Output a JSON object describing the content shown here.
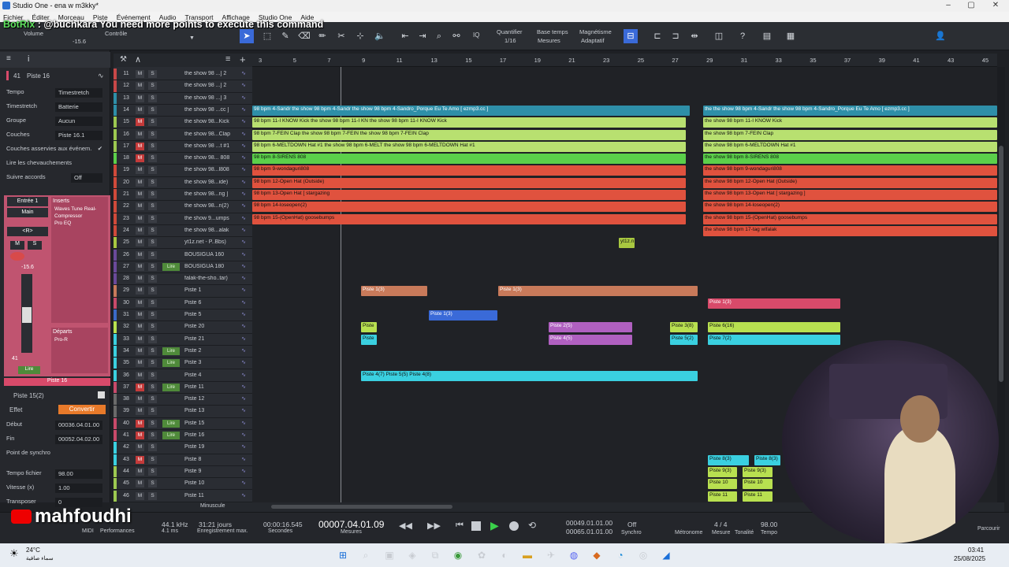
{
  "window": {
    "title": "Studio One - ena w m3kky*",
    "controls": [
      "–",
      "▢",
      "✕"
    ]
  },
  "menu": [
    "Fichier",
    "Éditer",
    "Morceau",
    "Piste",
    "Événement",
    "Audio",
    "Transport",
    "Affichage",
    "Studio One",
    "Aide"
  ],
  "chat_overlay": {
    "nick": "BotRix",
    "text": ": @buchkara You need more points to execute this command"
  },
  "toolbar": {
    "volume_label": "Volume",
    "controle_label": "Contrôle",
    "volume_value": "-15.6",
    "quantifier_label": "Quantifier",
    "quantifier_value": "1/16",
    "base_temps_label": "Base temps",
    "base_temps_value": "Mesures",
    "magnetisme_label": "Magnétisme",
    "magnetisme_value": "Adaptatif",
    "iq_label": "IQ"
  },
  "inspector": {
    "track_number": "41",
    "track_name": "Piste 16",
    "rows": [
      {
        "label": "Tempo",
        "value": "Timestretch"
      },
      {
        "label": "Timestretch",
        "value": "Batterie"
      },
      {
        "label": "Groupe",
        "value": "Aucun"
      },
      {
        "label": "Couches",
        "value": "Piste 16.1"
      },
      {
        "label": "Couches asservies aux événem.",
        "value": "✔"
      },
      {
        "label": "Lire les chevauchements",
        "value": ""
      },
      {
        "label": "Suivre accords",
        "value": "Off"
      }
    ],
    "entree": "Entrée 1",
    "main": "Main",
    "pan": "<R>",
    "m": "M",
    "s": "S",
    "fader_value": "-15.6",
    "fader_num": "41",
    "lire": "Lire",
    "inserts_label": "Inserts",
    "inserts": [
      "Waves Tune Real-",
      "Compressor",
      "Pro EQ"
    ],
    "departs_label": "Départs",
    "departs": [
      "Pro-R"
    ],
    "channel_name": "Piste 16",
    "event_name": "Piste 15(2)",
    "effet": "Effet",
    "convertir": "Convertir",
    "debut_label": "Début",
    "debut": "00036.04.01.00",
    "fin_label": "Fin",
    "fin": "00052.04.02.00",
    "point_synchro": "Point de synchro",
    "tempo_fichier_label": "Tempo fichier",
    "tempo_fichier": "98.00",
    "vitesse_label": "Vitesse (x)",
    "vitesse": "1.00",
    "transpose_label": "Transposer",
    "transpose": "0"
  },
  "ruler": [
    "3",
    "5",
    "7",
    "9",
    "11",
    "13",
    "15",
    "17",
    "19",
    "21",
    "23",
    "25",
    "27",
    "29",
    "31",
    "33",
    "35",
    "37",
    "39",
    "41",
    "43",
    "45"
  ],
  "tracks": [
    {
      "n": "11",
      "name": "the show 98 ...] 2",
      "color": "#c84848",
      "mute": false,
      "live": false
    },
    {
      "n": "12",
      "name": "the show 98 ...] 2",
      "color": "#c84848",
      "mute": false,
      "live": false
    },
    {
      "n": "13",
      "name": "the show 98 ...] 3",
      "color": "#2e8fa8",
      "mute": false,
      "live": false
    },
    {
      "n": "14",
      "name": "the show 98 ...cc ]",
      "color": "#2e8fa8",
      "mute": false,
      "live": false
    },
    {
      "n": "15",
      "name": "the show 98...Kick",
      "color": "#9cc850",
      "mute": true,
      "live": false
    },
    {
      "n": "16",
      "name": "the show 98...Clap",
      "color": "#9cc850",
      "mute": false,
      "live": false
    },
    {
      "n": "17",
      "name": "the show 98 ...t #1",
      "color": "#9cc850",
      "mute": true,
      "live": false
    },
    {
      "n": "18",
      "name": "the show 98... 808",
      "color": "#5bd04a",
      "mute": true,
      "live": false
    },
    {
      "n": "19",
      "name": "the show 98...l808",
      "color": "#d04a3a",
      "mute": false,
      "live": false
    },
    {
      "n": "20",
      "name": "the show 98...ide)",
      "color": "#d04a3a",
      "mute": false,
      "live": false
    },
    {
      "n": "21",
      "name": "the show 98...ng ]",
      "color": "#d04a3a",
      "mute": false,
      "live": false
    },
    {
      "n": "22",
      "name": "the show 98...n(2)",
      "color": "#d04a3a",
      "mute": false,
      "live": false
    },
    {
      "n": "23",
      "name": "the show 9...umps",
      "color": "#d04a3a",
      "mute": false,
      "live": false
    },
    {
      "n": "24",
      "name": "the show 98...alak",
      "color": "#d04a3a",
      "mute": false,
      "live": false
    },
    {
      "n": "25",
      "name": "yt1z.net - P..Bbs)",
      "color": "#a8c840",
      "mute": false,
      "live": false
    },
    {
      "n": "26",
      "name": "BOUSIGUA 160",
      "color": "#6a4a9a",
      "mute": false,
      "live": false
    },
    {
      "n": "27",
      "name": "BOUSIGUA 180",
      "color": "#6a4a9a",
      "mute": false,
      "live": true
    },
    {
      "n": "28",
      "name": "falak-the-sho..tar)",
      "color": "#6a4a9a",
      "mute": false,
      "live": false
    },
    {
      "n": "29",
      "name": "Piste 1",
      "color": "#c87a5a",
      "mute": false,
      "live": false
    },
    {
      "n": "30",
      "name": "Piste 6",
      "color": "#c84a6a",
      "mute": false,
      "live": false
    },
    {
      "n": "31",
      "name": "Piste 5",
      "color": "#3a6ac8",
      "mute": false,
      "live": false
    },
    {
      "n": "32",
      "name": "Piste 20",
      "color": "#b8e050",
      "mute": false,
      "live": false
    },
    {
      "n": "33",
      "name": "Piste 21",
      "color": "#3ad0e0",
      "mute": false,
      "live": false
    },
    {
      "n": "34",
      "name": "Piste 2",
      "color": "#3ad0e0",
      "mute": false,
      "live": true
    },
    {
      "n": "35",
      "name": "Piste 3",
      "color": "#3ad0e0",
      "mute": false,
      "live": true
    },
    {
      "n": "36",
      "name": "Piste 4",
      "color": "#3ad0e0",
      "mute": false,
      "live": false
    },
    {
      "n": "37",
      "name": "Piste 11",
      "color": "#c84a6a",
      "mute": true,
      "live": true
    },
    {
      "n": "38",
      "name": "Piste 12",
      "color": "#6a6a6a",
      "mute": false,
      "live": false
    },
    {
      "n": "39",
      "name": "Piste 13",
      "color": "#6a6a6a",
      "mute": false,
      "live": false
    },
    {
      "n": "40",
      "name": "Piste 15",
      "color": "#c84a6a",
      "mute": true,
      "live": true
    },
    {
      "n": "41",
      "name": "Piste 16",
      "color": "#c84a6a",
      "mute": true,
      "live": true
    },
    {
      "n": "42",
      "name": "Piste 19",
      "color": "#3ad0e0",
      "mute": false,
      "live": false
    },
    {
      "n": "43",
      "name": "Piste 8",
      "color": "#3ad0e0",
      "mute": true,
      "live": false
    },
    {
      "n": "44",
      "name": "Piste 9",
      "color": "#9cc850",
      "mute": false,
      "live": false
    },
    {
      "n": "45",
      "name": "Piste 10",
      "color": "#9cc850",
      "mute": false,
      "live": false
    },
    {
      "n": "46",
      "name": "Piste 11",
      "color": "#9cc850",
      "mute": false,
      "live": false
    }
  ],
  "clips": [
    {
      "row": 3,
      "c0": 0,
      "c1": 555,
      "color": "#2e8fa8",
      "text": "98 bpm 4-Sandr the show 98 bpm 4-Sandr the show 98 bpm 4-Sandro_Porque Eu Te Amo [ ezmp3.cc ]",
      "light": true
    },
    {
      "row": 3,
      "c0": 572,
      "c1": 945,
      "color": "#2e8fa8",
      "text": "the  the show 98 bpm 4-Sandr the show 98 bpm 4-Sandro_Porque Eu Te Amo [ ezmp3.cc ]",
      "light": true
    },
    {
      "row": 4,
      "c0": 0,
      "c1": 550,
      "color": "#b8e070",
      "text": "98 bpm 11-I KNOW Kick                                            the show 98 bpm 11-I KN the show 98 bpm 11-I KNOW Kick",
      "light": false
    },
    {
      "row": 4,
      "c0": 572,
      "c1": 945,
      "color": "#b8e070",
      "text": "the show 98 bpm 11-I KNOW Kick",
      "light": false
    },
    {
      "row": 5,
      "c0": 0,
      "c1": 550,
      "color": "#b8e070",
      "text": "98 bpm 7-FEIN Clap                                                the show 98 bpm 7-FEIN  the show 98 bpm 7-FEIN Clap",
      "light": false
    },
    {
      "row": 5,
      "c0": 572,
      "c1": 945,
      "color": "#b8e070",
      "text": "the show 98 bpm 7-FEIN Clap",
      "light": false
    },
    {
      "row": 6,
      "c0": 0,
      "c1": 550,
      "color": "#b8e070",
      "text": "98 bpm 6-MELTDOWN Hat #1                                          the show 98 bpm 6-MELT the show 98 bpm 6-MELTDOWN Hat #1",
      "light": false
    },
    {
      "row": 6,
      "c0": 572,
      "c1": 945,
      "color": "#b8e070",
      "text": "the show 98 bpm 6-MELTDOWN Hat #1",
      "light": false
    },
    {
      "row": 7,
      "c0": 0,
      "c1": 550,
      "color": "#5bd04a",
      "text": "98 bpm 8-SIRENS 808",
      "light": false
    },
    {
      "row": 7,
      "c0": 572,
      "c1": 945,
      "color": "#5bd04a",
      "text": "the show 98 bpm 8-SIRENS 808",
      "light": false
    },
    {
      "row": 8,
      "c0": 0,
      "c1": 550,
      "color": "#e0523e",
      "text": "98 bpm 9-wondaguri808",
      "light": false
    },
    {
      "row": 8,
      "c0": 572,
      "c1": 945,
      "color": "#e0523e",
      "text": "the show 98 bpm 9-wondaguri808",
      "light": false
    },
    {
      "row": 9,
      "c0": 0,
      "c1": 550,
      "color": "#e0523e",
      "text": "98 bpm 12-Open Hat (Outside)",
      "light": false
    },
    {
      "row": 9,
      "c0": 572,
      "c1": 945,
      "color": "#e0523e",
      "text": "the show 98 bpm 12-Open Hat (Outside)",
      "light": false
    },
    {
      "row": 10,
      "c0": 0,
      "c1": 550,
      "color": "#e0523e",
      "text": "98 bpm 13-Open Hat [ stargazing",
      "light": false
    },
    {
      "row": 10,
      "c0": 572,
      "c1": 945,
      "color": "#e0523e",
      "text": "the show 98 bpm 13-Open Hat [ stargazing ]",
      "light": false
    },
    {
      "row": 11,
      "c0": 0,
      "c1": 550,
      "color": "#e0523e",
      "text": "98 bpm 14-loseopen(2)",
      "light": false
    },
    {
      "row": 11,
      "c0": 572,
      "c1": 945,
      "color": "#e0523e",
      "text": "the show 98 bpm 14-loseopen(2)",
      "light": false
    },
    {
      "row": 12,
      "c0": 0,
      "c1": 550,
      "color": "#e0523e",
      "text": "98 bpm 15-(OpenHat) goosebumps",
      "light": false
    },
    {
      "row": 12,
      "c0": 572,
      "c1": 945,
      "color": "#e0523e",
      "text": "the show 98 bpm 15-(OpenHat) goosebumps",
      "light": false
    },
    {
      "row": 13,
      "c0": 572,
      "c1": 945,
      "color": "#e0523e",
      "text": "the show 98 bpm 17-tag wlfalak",
      "light": false
    },
    {
      "row": 14,
      "c0": 465,
      "c1": 485,
      "color": "#a8c840",
      "text": "yt1z.n",
      "light": false
    },
    {
      "row": 18,
      "c0": 138,
      "c1": 222,
      "color": "#c87a5a",
      "text": "Piste 1(3)",
      "light": true
    },
    {
      "row": 18,
      "c0": 312,
      "c1": 565,
      "color": "#c87a5a",
      "text": "Piste 1(3)",
      "light": true
    },
    {
      "row": 19,
      "c0": 578,
      "c1": 746,
      "color": "#d84a6a",
      "text": "Piste 1(3)",
      "light": true
    },
    {
      "row": 20,
      "c0": 224,
      "c1": 311,
      "color": "#3a6ad8",
      "text": "Piste 1(3)",
      "light": true
    },
    {
      "row": 21,
      "c0": 138,
      "c1": 158,
      "color": "#b8e050",
      "text": "Piste",
      "light": false
    },
    {
      "row": 21,
      "c0": 376,
      "c1": 482,
      "color": "#b060c0",
      "text": "Piste 2(5)",
      "light": true
    },
    {
      "row": 21,
      "c0": 530,
      "c1": 565,
      "color": "#b8e050",
      "text": "Piste 3(8)",
      "light": false
    },
    {
      "row": 21,
      "c0": 578,
      "c1": 746,
      "color": "#b8e050",
      "text": "Piste 6(16)",
      "light": false
    },
    {
      "row": 22,
      "c0": 138,
      "c1": 158,
      "color": "#3ad0e0",
      "text": "Piste",
      "light": false
    },
    {
      "row": 22,
      "c0": 376,
      "c1": 482,
      "color": "#b060c0",
      "text": "Piste 4(5)",
      "light": true
    },
    {
      "row": 22,
      "c0": 530,
      "c1": 565,
      "color": "#3ad0e0",
      "text": "Piste 5(2)",
      "light": false
    },
    {
      "row": 22,
      "c0": 578,
      "c1": 746,
      "color": "#3ad0e0",
      "text": "Piste 7(2)",
      "light": false
    },
    {
      "row": 25,
      "c0": 138,
      "c1": 565,
      "color": "#3ad0e0",
      "text": "Piste 4(7)                                                                                                           Piste 5(5)  Piste 4(8)",
      "light": false
    },
    {
      "row": 32,
      "c0": 578,
      "c1": 630,
      "color": "#3ad0e0",
      "text": "Piste 8(3)",
      "light": false
    },
    {
      "row": 32,
      "c0": 637,
      "c1": 670,
      "color": "#3ad0e0",
      "text": "Piste 8(3)",
      "light": false
    },
    {
      "row": 33,
      "c0": 578,
      "c1": 615,
      "color": "#b8e050",
      "text": "Piste 9(3)",
      "light": false
    },
    {
      "row": 33,
      "c0": 622,
      "c1": 660,
      "color": "#b8e050",
      "text": "Piste 9(3)",
      "light": false
    },
    {
      "row": 34,
      "c0": 578,
      "c1": 615,
      "color": "#b8e050",
      "text": "Piste 10",
      "light": false
    },
    {
      "row": 34,
      "c0": 622,
      "c1": 660,
      "color": "#b8e050",
      "text": "Piste 10",
      "light": false
    },
    {
      "row": 35,
      "c0": 578,
      "c1": 615,
      "color": "#b8e050",
      "text": "Piste 11",
      "light": false
    },
    {
      "row": 35,
      "c0": 622,
      "c1": 660,
      "color": "#b8e050",
      "text": "Piste 11",
      "light": false
    }
  ],
  "arrange_bottom": {
    "zoom": "Minuscule"
  },
  "transport": {
    "sample_rate": "44.1 kHz",
    "latency": "4.1 ms",
    "record_time": "31:21 jours",
    "record_label": "Enregistrement max.",
    "midi": "MIDI",
    "performances": "Performances",
    "seconds": "00:00:16.545",
    "seconds_label": "Secondes",
    "position": "00007.04.01.09",
    "position_label": "Mesures",
    "loop_start": "00049.01.01.00",
    "loop_end": "00065.01.01.00",
    "sync_off": "Off",
    "sync_label": "Synchro",
    "metronome": "Métronome",
    "signature": "4 / 4",
    "mesure_label": "Mesure",
    "tonalite_label": "Tonalité",
    "tempo": "98.00",
    "tempo_label": "Tempo",
    "parcourir": "Parcourir"
  },
  "stream_name": "mahfoudhi",
  "taskbar": {
    "temp": "24°C",
    "weather": "سماء صافية",
    "time": "03:41",
    "date": "25/08/2025"
  }
}
